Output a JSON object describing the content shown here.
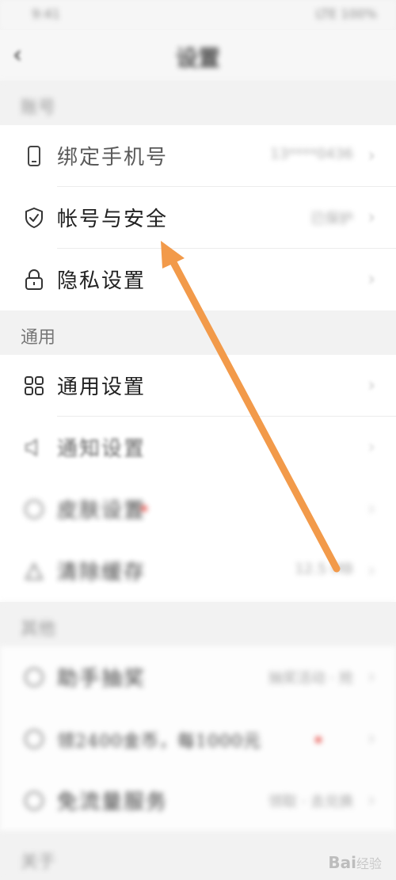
{
  "status_bar": {
    "left": "9:41",
    "right": "LTE 100%"
  },
  "nav": {
    "back_icon": "chevron-left-icon",
    "title": "设置"
  },
  "sections": {
    "account": "账号",
    "general": "通用",
    "misc": "其他",
    "about": "关于"
  },
  "rows": {
    "bind_phone": {
      "label": "绑定手机号",
      "value": "13****0436",
      "icon": "phone-icon"
    },
    "account_sec": {
      "label": "帐号与安全",
      "value": "已保护",
      "icon": "shield-icon"
    },
    "privacy": {
      "label": "隐私设置",
      "value": "",
      "icon": "lock-icon"
    },
    "general_set": {
      "label": "通用设置",
      "value": "",
      "icon": "grid-icon"
    },
    "notify": {
      "label": "通知设置",
      "value": "",
      "icon": "speaker-icon"
    },
    "theme": {
      "label": "皮肤设置",
      "value": "",
      "icon": "palette-icon"
    },
    "clear_cache": {
      "label": "清除缓存",
      "value": "12.5 MB",
      "icon": "broom-icon"
    },
    "mini_game": {
      "label": "助手抽奖",
      "value": "抽奖活动 · 抢",
      "icon": "gift-icon"
    },
    "promo": {
      "label": "领2400金币，每1000元",
      "value": "",
      "icon": "coin-icon"
    },
    "cleanup": {
      "label": "免流量服务",
      "value": "领取 · 去兑换",
      "icon": "flow-icon"
    }
  },
  "watermark": {
    "brand": "Bai",
    "suffix": "经验"
  },
  "accent_color": "#f29a4a"
}
